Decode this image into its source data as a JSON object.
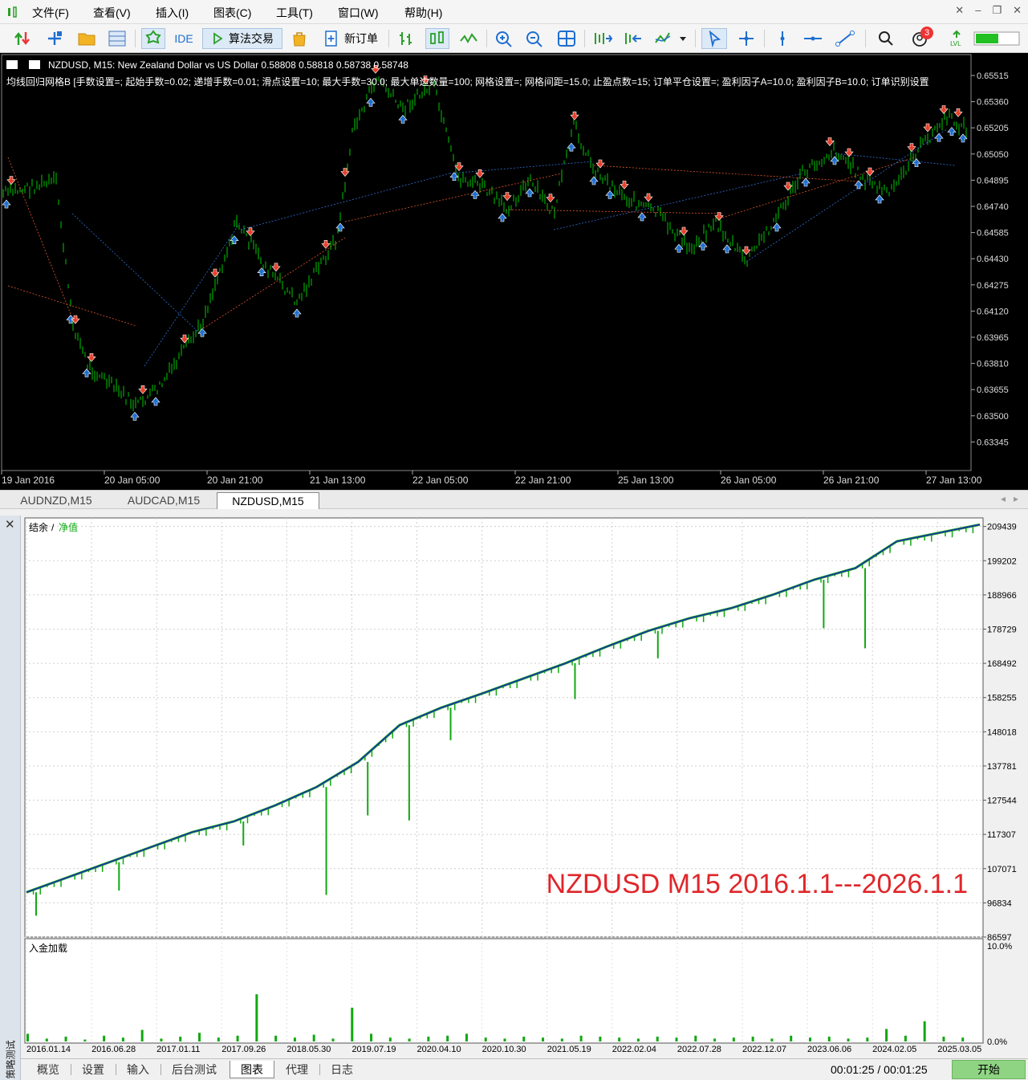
{
  "menu": {
    "items": [
      "文件(F)",
      "查看(V)",
      "插入(I)",
      "图表(C)",
      "工具(T)",
      "窗口(W)",
      "帮助(H)"
    ]
  },
  "toolbar": {
    "ide_label": "IDE",
    "algo_trading_label": "算法交易",
    "new_order_label": "新订单",
    "notification_count": "3",
    "icons": [
      "one-click-trading-icon",
      "add-icon",
      "folder-icon",
      "strategy-tester-icon",
      "market-icon",
      "ide-icon",
      "play-icon",
      "bag-icon",
      "new-order-icon",
      "bar-chart-icon",
      "candlestick-icon",
      "line-chart-icon",
      "zoom-in-icon",
      "zoom-out-icon",
      "tile-windows-icon",
      "scroll-right-icon",
      "autoscroll-icon",
      "indicators-icon",
      "cursor-icon",
      "crosshair-icon",
      "vertical-line-icon",
      "horizontal-line-icon",
      "trend-line-icon",
      "search-icon",
      "account-icon",
      "signal-icon",
      "connection-bar-icon"
    ]
  },
  "chart": {
    "header": "NZDUSD, M15:  New Zealand Dollar vs US Dollar  0.58808 0.58818 0.58738 0.58748",
    "ea_params": "均线回归网格B [手数设置=; 起始手数=0.02; 递增手数=0.01; 滑点设置=10; 最大手数=30.0; 最大单边数量=100; 网格设置=; 网格间距=15.0; 止盈点数=15; 订单平仓设置=; 盈利因子A=10.0; 盈利因子B=10.0; 订单识别设置",
    "price_axis": [
      "0.65515",
      "0.65360",
      "0.65205",
      "0.65050",
      "0.64895",
      "0.64740",
      "0.64585",
      "0.64430",
      "0.64275",
      "0.64120",
      "0.63965",
      "0.63810",
      "0.63655",
      "0.63500",
      "0.63345"
    ],
    "time_axis": [
      "19 Jan 2016",
      "20 Jan 05:00",
      "20 Jan 21:00",
      "21 Jan 13:00",
      "22 Jan 05:00",
      "22 Jan 21:00",
      "25 Jan 13:00",
      "26 Jan 05:00",
      "26 Jan 21:00",
      "27 Jan 13:00"
    ],
    "colors": {
      "background": "#000000",
      "bars": "#00c800",
      "buy_arrow": "#1e6fd0",
      "sell_arrow": "#e8402a"
    }
  },
  "chart_tabs": [
    "AUDNZD,M15",
    "AUDCAD,M15",
    "NZDUSD,M15"
  ],
  "chart_tab_active": "NZDUSD,M15",
  "tester": {
    "graph_legend_balance": "结余",
    "graph_legend_sep": "/",
    "graph_legend_equity": "净值",
    "deposit_load_label": "入金加载",
    "vertical_label": "策略测试",
    "overlay_text": "NZDUSD M15 2016.1.1---2026.1.1",
    "timer": "00:01:25 / 00:01:25",
    "start_button": "开始"
  },
  "bottom_tabs": [
    "概览",
    "设置",
    "输入",
    "后台测试",
    "图表",
    "代理",
    "日志"
  ],
  "bottom_tab_active": "图表",
  "chart_data": [
    {
      "type": "line",
      "title": "",
      "series": [
        {
          "name": "结余",
          "color": "#1c2fb0"
        },
        {
          "name": "净值",
          "color": "#11a811"
        }
      ],
      "x": [
        "2016.01.14",
        "2016.06.28",
        "2017.01.11",
        "2017.09.26",
        "2018.05.30",
        "2019.07.19",
        "2020.04.10",
        "2020.10.30",
        "2021.05.19",
        "2022.02.04",
        "2022.07.28",
        "2022.12.07",
        "2023.06.06",
        "2024.02.05",
        "2025.03.05"
      ],
      "y_ticks": [
        "209439",
        "199202",
        "188966",
        "178729",
        "168492",
        "158255",
        "148018",
        "137781",
        "127544",
        "117307",
        "107071",
        "96834",
        "86597"
      ],
      "ylim": [
        86597,
        212000
      ],
      "balance_values": [
        100000,
        104500,
        109000,
        113500,
        118000,
        121200,
        126000,
        131500,
        139000,
        150000,
        155200,
        159500,
        164000,
        168500,
        173500,
        178200,
        182000,
        185000,
        189000,
        193500,
        197000,
        205000,
        207500,
        210000
      ],
      "equity_drawdowns": [
        {
          "index": 0,
          "value": 93000
        },
        {
          "index": 2,
          "value": 100500
        },
        {
          "index": 5,
          "value": 114000
        },
        {
          "index": 7,
          "value": 99200
        },
        {
          "index": 8,
          "value": 123000
        },
        {
          "index": 9,
          "value": 121500
        },
        {
          "index": 10,
          "value": 145500
        },
        {
          "index": 13,
          "value": 157800
        },
        {
          "index": 15,
          "value": 170000
        },
        {
          "index": 19,
          "value": 179000
        },
        {
          "index": 20,
          "value": 173000
        }
      ]
    },
    {
      "type": "bar",
      "title": "入金加载",
      "ylim": [
        0,
        10
      ],
      "y_ticks": [
        "10.0%",
        "0.0%"
      ],
      "values": [
        0.8,
        0.3,
        0.5,
        0.2,
        0.6,
        0.4,
        1.2,
        0.3,
        0.5,
        0.9,
        0.4,
        0.6,
        4.9,
        0.6,
        0.4,
        0.7,
        0.3,
        3.5,
        0.8,
        0.4,
        0.3,
        0.5,
        0.6,
        0.8,
        0.4,
        0.3,
        0.5,
        0.4,
        0.3,
        0.6,
        0.5,
        0.4,
        0.3,
        0.5,
        0.4,
        0.6,
        0.3,
        0.4,
        0.5,
        0.3,
        0.6,
        0.4,
        0.5,
        0.3,
        0.4,
        1.3,
        0.6,
        2.1,
        0.5,
        0.4
      ]
    }
  ]
}
